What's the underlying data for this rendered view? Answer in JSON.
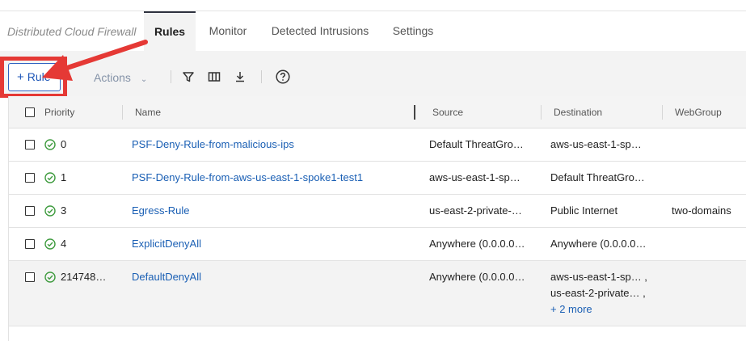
{
  "app": {
    "product_name": "Distributed Cloud Firewall"
  },
  "tabs": [
    {
      "label": "Rules",
      "active": true
    },
    {
      "label": "Monitor",
      "active": false
    },
    {
      "label": "Detected Intrusions",
      "active": false
    },
    {
      "label": "Settings",
      "active": false
    }
  ],
  "toolbar": {
    "add_rule_label": "Rule",
    "add_rule_icon": "plus-icon",
    "actions_label": "Actions",
    "icons": [
      "filter-icon",
      "columns-icon",
      "download-icon",
      "help-icon"
    ]
  },
  "table": {
    "columns": [
      "Priority",
      "Name",
      "Source",
      "Destination",
      "WebGroup"
    ],
    "rows": [
      {
        "priority": "0",
        "name": "PSF-Deny-Rule-from-malicious-ips",
        "source": "Default ThreatGro…",
        "destination": [
          "aws-us-east-1-sp…"
        ],
        "more": "",
        "webgroup": ""
      },
      {
        "priority": "1",
        "name": "PSF-Deny-Rule-from-aws-us-east-1-spoke1-test1",
        "source": "aws-us-east-1-sp…",
        "destination": [
          "Default ThreatGro…"
        ],
        "more": "",
        "webgroup": ""
      },
      {
        "priority": "3",
        "name": "Egress-Rule",
        "source": "us-east-2-private-…",
        "destination": [
          "Public Internet"
        ],
        "more": "",
        "webgroup": "two-domains"
      },
      {
        "priority": "4",
        "name": "ExplicitDenyAll",
        "source": "Anywhere (0.0.0.0…",
        "destination": [
          "Anywhere (0.0.0.0…"
        ],
        "more": "",
        "webgroup": ""
      },
      {
        "priority": "214748…",
        "name": "DefaultDenyAll",
        "source": "Anywhere (0.0.0.0…",
        "destination": [
          "aws-us-east-1-sp… ,",
          "us-east-2-private… ,"
        ],
        "more": "+ 2 more",
        "webgroup": ""
      }
    ]
  },
  "colors": {
    "accent": "#1e56b8",
    "link": "#1a5fb4",
    "status_ok": "#3f9b3f",
    "annotation": "#e53935"
  }
}
